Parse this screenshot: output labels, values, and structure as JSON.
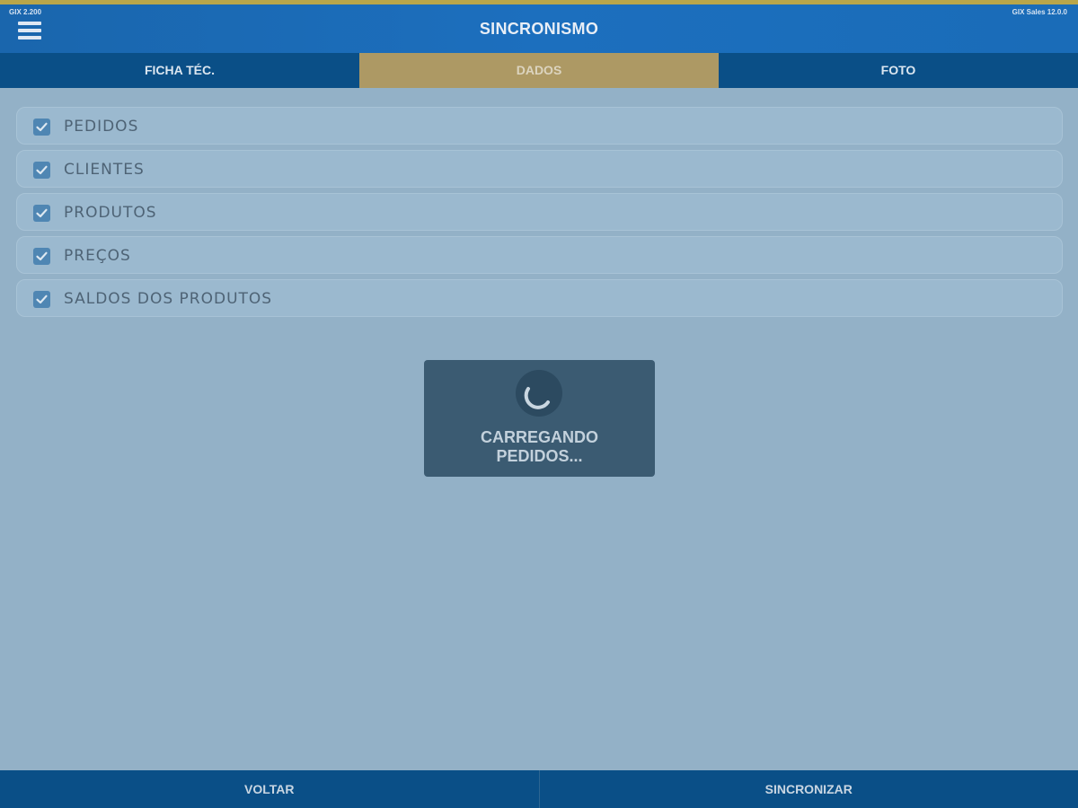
{
  "header": {
    "title": "SINCRONISMO",
    "version_left": "GIX 2.200",
    "version_right": "GIX Sales 12.0.0"
  },
  "tabs": [
    {
      "label": "FICHA TÉC.",
      "active": false
    },
    {
      "label": "DADOS",
      "active": true
    },
    {
      "label": "FOTO",
      "active": false
    }
  ],
  "options": [
    {
      "label": "PEDIDOS",
      "checked": true
    },
    {
      "label": "CLIENTES",
      "checked": true
    },
    {
      "label": "PRODUTOS",
      "checked": true
    },
    {
      "label": "PREÇOS",
      "checked": true
    },
    {
      "label": "SALDOS DOS PRODUTOS",
      "checked": true
    }
  ],
  "loading": {
    "line1": "CARREGANDO",
    "line2": "PEDIDOS..."
  },
  "footer": {
    "back_label": "VOLTAR",
    "sync_label": "SINCRONIZAR"
  },
  "icons": {
    "menu": "hamburger-menu-icon",
    "checkbox": "checkmark-icon",
    "spinner": "loading-spinner-icon"
  },
  "colors": {
    "header_bg": "#1c6fbe",
    "tab_bg": "#0a4f87",
    "tab_active_bg": "#ad9964",
    "overlay_bg": "#93b1c7",
    "checkbox_bg": "#4f86b3",
    "loading_bg": "#3b5b72",
    "accent_top": "#b9a64a"
  }
}
